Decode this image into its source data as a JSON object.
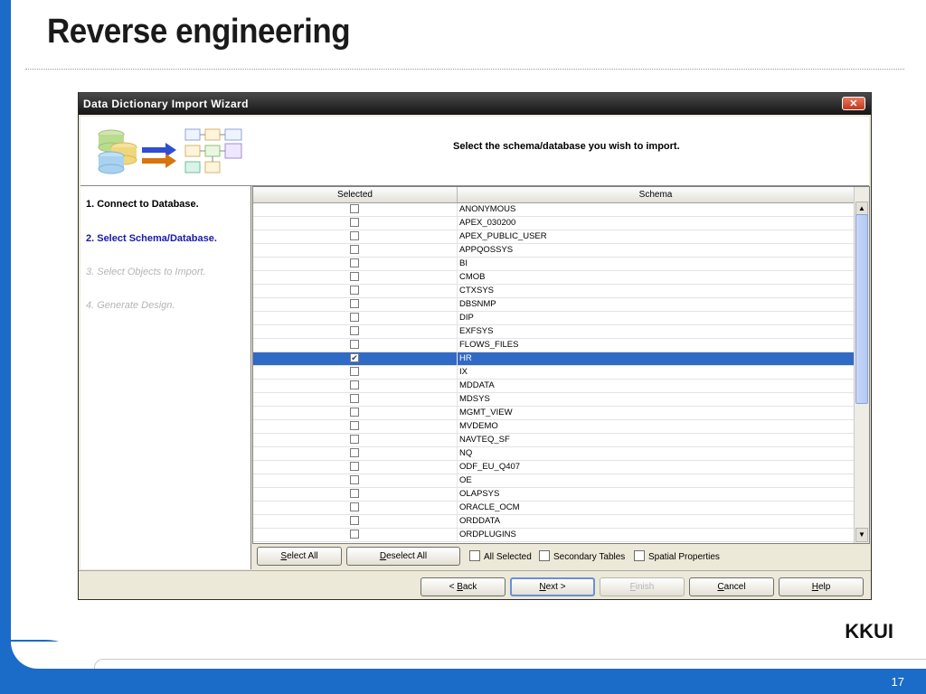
{
  "slide": {
    "title": "Reverse engineering",
    "brand": "KKUI",
    "page_number": "17"
  },
  "window": {
    "title": "Data Dictionary Import Wizard",
    "close_glyph": "✕",
    "instruction": "Select the schema/database you wish to import."
  },
  "steps": [
    {
      "label": "1. Connect to Database.",
      "state": "done"
    },
    {
      "label": "2. Select Schema/Database.",
      "state": "current"
    },
    {
      "label": "3. Select Objects to Import.",
      "state": "todo"
    },
    {
      "label": "4. Generate Design.",
      "state": "todo"
    }
  ],
  "table": {
    "columns": [
      "Selected",
      "Schema"
    ],
    "rows": [
      {
        "name": "ANONYMOUS",
        "checked": false
      },
      {
        "name": "APEX_030200",
        "checked": false
      },
      {
        "name": "APEX_PUBLIC_USER",
        "checked": false
      },
      {
        "name": "APPQOSSYS",
        "checked": false
      },
      {
        "name": "BI",
        "checked": false
      },
      {
        "name": "CMOB",
        "checked": false
      },
      {
        "name": "CTXSYS",
        "checked": false
      },
      {
        "name": "DBSNMP",
        "checked": false
      },
      {
        "name": "DIP",
        "checked": false
      },
      {
        "name": "EXFSYS",
        "checked": false
      },
      {
        "name": "FLOWS_FILES",
        "checked": false
      },
      {
        "name": "HR",
        "checked": true,
        "selected": true
      },
      {
        "name": "IX",
        "checked": false
      },
      {
        "name": "MDDATA",
        "checked": false
      },
      {
        "name": "MDSYS",
        "checked": false
      },
      {
        "name": "MGMT_VIEW",
        "checked": false
      },
      {
        "name": "MVDEMO",
        "checked": false
      },
      {
        "name": "NAVTEQ_SF",
        "checked": false
      },
      {
        "name": "NQ",
        "checked": false
      },
      {
        "name": "ODF_EU_Q407",
        "checked": false
      },
      {
        "name": "OE",
        "checked": false
      },
      {
        "name": "OLAPSYS",
        "checked": false
      },
      {
        "name": "ORACLE_OCM",
        "checked": false
      },
      {
        "name": "ORDDATA",
        "checked": false
      },
      {
        "name": "ORDPLUGINS",
        "checked": false
      }
    ],
    "scroll_up_glyph": "▲",
    "scroll_down_glyph": "▼"
  },
  "selection": {
    "select_all": {
      "mn": "S",
      "rest": "elect All"
    },
    "deselect_all": {
      "mn": "D",
      "rest": "eselect All"
    },
    "all_selected_label": "All Selected",
    "secondary_tables_label": "Secondary Tables",
    "spatial_properties_label": "Spatial Properties"
  },
  "nav": {
    "back": {
      "pre": "< ",
      "mn": "B",
      "rest": "ack"
    },
    "next": {
      "mn": "N",
      "rest": "ext >"
    },
    "finish": {
      "mn": "F",
      "rest": "inish"
    },
    "cancel": {
      "mn": "C",
      "rest": "ancel"
    },
    "help": {
      "mn": "H",
      "rest": "elp"
    }
  },
  "colors": {
    "slide_accent": "#1B6BC8",
    "row_selected": "#316AC5",
    "current_step": "#1A1AA6"
  }
}
